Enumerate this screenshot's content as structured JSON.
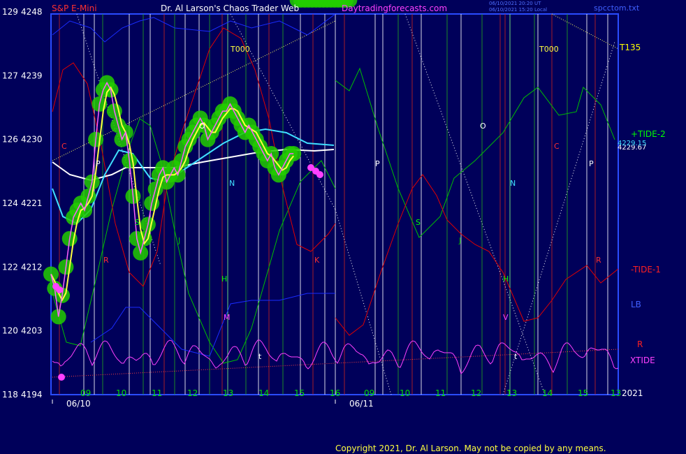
{
  "header": {
    "symbol": "S&P E-Mini",
    "title": "Dr. Al Larson's Chaos Trader Web",
    "site": "Daytradingforecasts.com",
    "stamp_line1": "06/10/2021 20:20 UT",
    "stamp_line2": "06/10/2021 15:20 Local",
    "file": "spcctom.txt"
  },
  "footer": {
    "copyright": "Copyright 2021, Dr. Al Larson. May not be copied by any means."
  },
  "chart_data": {
    "type": "line",
    "y_axis_left": {
      "ticks": [
        {
          "count": "129",
          "price": 4248
        },
        {
          "count": "127",
          "price": 4239
        },
        {
          "count": "126",
          "price": 4230
        },
        {
          "count": "124",
          "price": 4221
        },
        {
          "count": "122",
          "price": 4212
        },
        {
          "count": "120",
          "price": 4203
        },
        {
          "count": "118",
          "price": 4194
        }
      ],
      "ylim": [
        4194,
        4248
      ]
    },
    "x_axis": {
      "hour_ticks": [
        "09",
        "10",
        "11",
        "12",
        "13",
        "14",
        "15",
        "16",
        "09",
        "10",
        "11",
        "12",
        "13",
        "14",
        "15",
        "13"
      ],
      "date_labels": [
        "06/10",
        "06/11"
      ],
      "year_label": "2021",
      "xlim_hours": [
        8.0,
        23.2
      ]
    },
    "price_series": {
      "name": "",
      "x": [
        8.0,
        8.1,
        8.2,
        8.3,
        8.4,
        8.5,
        8.6,
        8.7,
        8.8,
        8.9,
        9.0,
        9.1,
        9.2,
        9.3,
        9.4,
        9.5,
        9.6,
        9.7,
        9.8,
        9.9,
        10.0,
        10.1,
        10.2,
        10.3,
        10.4,
        10.5,
        10.6,
        10.7,
        10.8,
        10.9,
        11.0,
        11.1,
        11.2,
        11.3,
        11.4,
        11.5,
        11.6,
        11.7,
        11.8,
        11.9,
        12.0,
        12.1,
        12.2,
        12.3,
        12.4,
        12.5,
        12.6,
        12.7,
        12.8,
        12.9,
        13.0,
        13.1,
        13.2,
        13.3,
        13.4,
        13.5,
        13.6,
        13.7,
        13.8,
        13.9,
        14.0,
        14.1,
        14.2,
        14.3,
        14.4,
        14.5,
        14.6,
        14.7,
        14.8,
        14.9,
        15.0,
        15.1,
        15.2,
        15.3,
        15.4,
        15.5,
        15.6,
        15.7,
        15.8,
        15.9,
        16.0
      ],
      "values": [
        4211,
        4209,
        4205,
        4208,
        4212,
        4216,
        4219,
        4220,
        4221,
        4220,
        4222,
        4224,
        4230,
        4235,
        4237,
        4238,
        4237,
        4234,
        4232,
        4230,
        4231,
        4227,
        4222,
        4216,
        4214,
        4216,
        4218,
        4221,
        4223,
        4225,
        4226,
        4224,
        4225,
        4226,
        4225,
        4227,
        4229,
        4230,
        4231,
        4232,
        4233,
        4232,
        4230,
        4231,
        4232,
        4233,
        4234,
        4234,
        4235,
        4234,
        4233,
        4232,
        4231,
        4232,
        4231,
        4230,
        4229,
        4228,
        4227,
        4228,
        4226,
        4225,
        4226,
        4227,
        4228,
        4228
      ],
      "close_label": "4229.67",
      "close_label_2": "4229.15"
    },
    "band_ellipse_series": "green highlights",
    "reference_lines": [
      {
        "label": "T000",
        "x_hour": 13.0
      },
      {
        "label": "T000",
        "x_hour": 21.0
      }
    ],
    "marker_letters": [
      "C",
      "P",
      "S",
      "J",
      "H",
      "M",
      "O",
      "N",
      "R",
      "t",
      "K",
      "P",
      "S",
      "J",
      "O",
      "N",
      "H",
      "V",
      "C",
      "P",
      "R",
      "t"
    ],
    "right_labels": [
      {
        "text": "T135",
        "color": "#ffff00"
      },
      {
        "text": "+TIDE-2",
        "color": "#00ff00"
      },
      {
        "text": "-TIDE-1",
        "color": "#ff2020"
      },
      {
        "text": "LB",
        "color": "#4060ff"
      },
      {
        "text": "R",
        "color": "#ff2020"
      },
      {
        "text": "XTIDE",
        "color": "#ff40ff"
      }
    ],
    "colors": {
      "background": "#00005a",
      "frame": "#2a4cff",
      "price": "#ff60ff",
      "ma_fast": "#ffff40",
      "ma_mid": "#40e0ff",
      "ma_slow": "#ffffff",
      "highlight": "#22cc00",
      "tide_green": "#00c000",
      "tide_red": "#e00000",
      "lb_blue": "#1a2cff",
      "xtide": "#ff40ff"
    }
  }
}
